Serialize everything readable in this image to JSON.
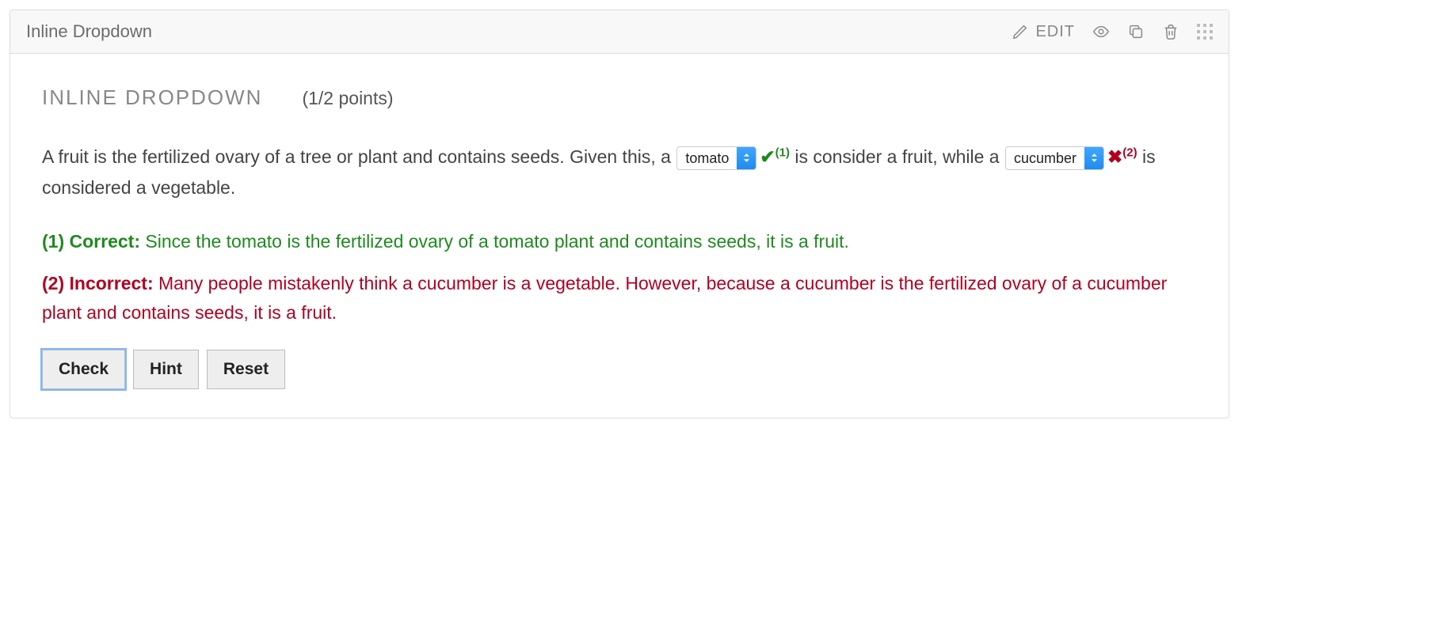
{
  "header": {
    "title": "Inline Dropdown",
    "edit_label": "EDIT"
  },
  "problem": {
    "title": "INLINE DROPDOWN",
    "points": "(1/2 points)",
    "q_part1": "A fruit is the fertilized ovary of a tree or plant and contains seeds. Given this, a ",
    "q_part2": " is consider a fruit, while a ",
    "q_part3": " is considered a vegetable.",
    "select1": {
      "value": "tomato",
      "correct": true,
      "ref": "(1)"
    },
    "select2": {
      "value": "cucumber",
      "correct": false,
      "ref": "(2)"
    }
  },
  "feedback": {
    "correct": {
      "ref": "(1)",
      "label": "Correct:",
      "text": "Since the tomato is the fertilized ovary of a tomato plant and contains seeds, it is a fruit."
    },
    "incorrect": {
      "ref": "(2)",
      "label": "Incorrect:",
      "text": "Many people mistakenly think a cucumber is a vegetable. However, because a cucumber is the fertilized ovary of a cucumber plant and contains seeds, it is a fruit."
    }
  },
  "buttons": {
    "check": "Check",
    "hint": "Hint",
    "reset": "Reset"
  }
}
